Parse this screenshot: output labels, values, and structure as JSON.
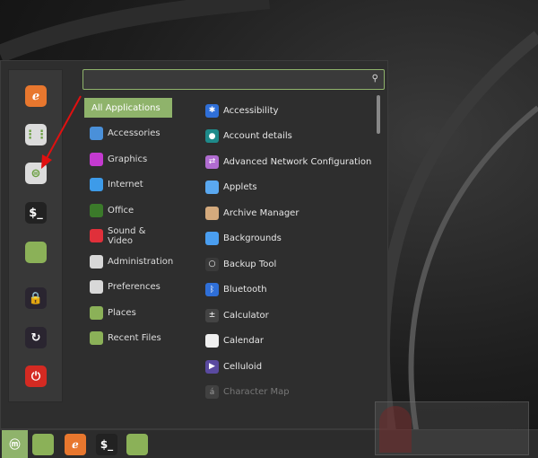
{
  "search": {
    "placeholder": "",
    "icon": "search-icon"
  },
  "sidebar": [
    {
      "name": "firefox",
      "color": "#e8772e"
    },
    {
      "name": "software-manager",
      "color": "#dcdcdc"
    },
    {
      "name": "system-settings",
      "color": "#dcdcdc"
    },
    {
      "name": "terminal",
      "color": "#222222"
    },
    {
      "name": "files",
      "color": "#8bb158"
    },
    {
      "name": "lock-screen",
      "color": "#2a2530"
    },
    {
      "name": "logout",
      "color": "#2a2530"
    },
    {
      "name": "quit",
      "color": "#d42a22"
    }
  ],
  "categories": [
    {
      "label": "All Applications",
      "color": ""
    },
    {
      "label": "Accessories",
      "color": "#4a90d9"
    },
    {
      "label": "Graphics",
      "color": "#c43ad0"
    },
    {
      "label": "Internet",
      "color": "#3d9be9"
    },
    {
      "label": "Office",
      "color": "#3b7a2a"
    },
    {
      "label": "Sound & Video",
      "color": "#e0303a"
    },
    {
      "label": "Administration",
      "color": "#d8d8d8"
    },
    {
      "label": "Preferences",
      "color": "#d8d8d8"
    },
    {
      "label": "Places",
      "color": "#8bb158"
    },
    {
      "label": "Recent Files",
      "color": "#8bb158"
    }
  ],
  "apps": [
    {
      "label": "Accessibility",
      "color": "#2f6fd8",
      "glyph": "✱"
    },
    {
      "label": "Account details",
      "color": "#1e8a8a",
      "glyph": "●"
    },
    {
      "label": "Advanced Network Configuration",
      "color": "#b06cd0",
      "glyph": "⇄"
    },
    {
      "label": "Applets",
      "color": "#5aa8f0",
      "glyph": ""
    },
    {
      "label": "Archive Manager",
      "color": "#d4aa7d",
      "glyph": ""
    },
    {
      "label": "Backgrounds",
      "color": "#4a9ef0",
      "glyph": ""
    },
    {
      "label": "Backup Tool",
      "color": "#3a3a3a",
      "glyph": "○"
    },
    {
      "label": "Bluetooth",
      "color": "#2f6fd8",
      "glyph": "ᛒ"
    },
    {
      "label": "Calculator",
      "color": "#444444",
      "glyph": "±"
    },
    {
      "label": "Calendar",
      "color": "#f0f0f0",
      "glyph": ""
    },
    {
      "label": "Celluloid",
      "color": "#5a4aa0",
      "glyph": "▶"
    },
    {
      "label": "Character Map",
      "color": "#555555",
      "glyph": "á"
    }
  ],
  "panel": [
    {
      "name": "mint-menu",
      "color": "#8fb36b"
    },
    {
      "name": "show-desktop",
      "color": "#8bb158"
    },
    {
      "name": "firefox",
      "color": "#e8772e"
    },
    {
      "name": "terminal",
      "color": "#222222"
    },
    {
      "name": "files",
      "color": "#8bb158"
    }
  ]
}
